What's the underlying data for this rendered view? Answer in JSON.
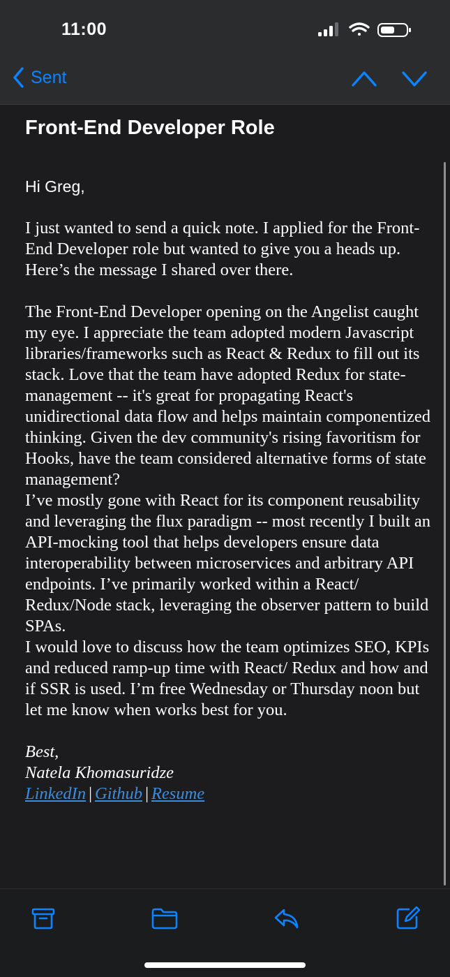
{
  "status_bar": {
    "time": "11:00"
  },
  "nav": {
    "back_label": "Sent"
  },
  "email": {
    "subject": "Front-End Developer Role",
    "greeting": "Hi Greg,",
    "paragraph1": "I just wanted to send a quick note. I applied for the Front-End Developer role but wanted to give you a heads up. Here’s the message I shared over there.",
    "paragraph2a": "The Front-End Developer opening on the Angelist caught my eye. I appreciate the team adopted modern Javascript libraries/frameworks such as React & Redux to fill out its stack. Love that the team have adopted Redux for state-management -- it's great for propagating React's unidirectional data flow and helps maintain componentized thinking. Given the dev community's rising favoritism for Hooks, have the team considered alternative forms of state management?",
    "paragraph2b": "I’ve mostly gone with React for its component reusability and leveraging the flux paradigm -- most recently I built an API-mocking tool that helps developers ensure data interoperability between microservices and arbitrary API endpoints. I’ve primarily worked within a React/ Redux/Node stack, leveraging the observer pattern to build SPAs.",
    "paragraph2c": "I would love to discuss how the team optimizes SEO, KPIs and reduced ramp-up time with React/ Redux and how and if SSR is used. I’m free Wednesday or Thursday noon but let me know when works best for you.",
    "signoff": "Best,",
    "sender": "Natela Khomasuridze",
    "links": {
      "linkedin": "LinkedIn",
      "github": "Github",
      "resume": "Resume",
      "separator": "|"
    }
  },
  "icons": {
    "back": "chevron-left-icon",
    "up": "chevron-up-icon",
    "down": "chevron-down-icon",
    "archive": "archive-icon",
    "folder": "folder-icon",
    "reply": "reply-icon",
    "compose": "compose-icon"
  },
  "colors": {
    "accent": "#0a84ff",
    "link": "#3a8dde",
    "background": "#1c1c1e",
    "header": "#2b2c2e"
  }
}
